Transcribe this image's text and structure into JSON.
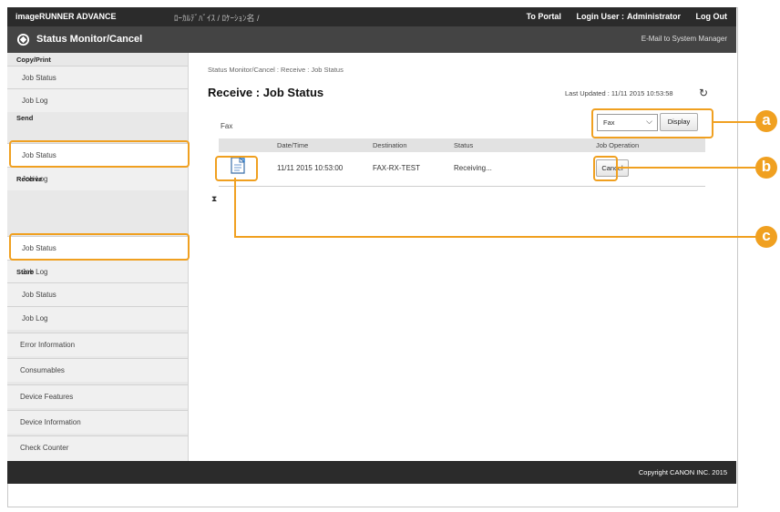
{
  "topbar": {
    "brand": "imageRUNNER ADVANCE",
    "device": "ﾛｰｶﾙﾃﾞﾊﾞｲｽ / ﾛｹｰｼｮﾝ名 /",
    "portal": "To Portal",
    "login_user": "Login User :",
    "user": "Administrator",
    "logout": "Log Out"
  },
  "subbar": {
    "title": "Status Monitor/Cancel",
    "mail_link": "E-Mail to System Manager"
  },
  "sidebar": {
    "groups": [
      {
        "heading": "Copy/Print",
        "items": [
          "Job Status",
          "Job Log"
        ]
      },
      {
        "heading": "Send",
        "items": [
          "Job Status",
          "Job Log"
        ]
      },
      {
        "heading": "Receive",
        "items": [
          "Job Status",
          "Job Log"
        ]
      },
      {
        "heading": "Store",
        "items": [
          "Job Status",
          "Job Log"
        ]
      }
    ],
    "extra_items": [
      "Error Information",
      "Consumables",
      "Device Features",
      "Device Information",
      "Check Counter"
    ]
  },
  "main": {
    "breadcrumb": "Status Monitor/Cancel : Receive : Job Status",
    "title": "Receive : Job Status",
    "last_updated": "Last Updated : 11/11 2015 10:53:58",
    "section_label": "Fax",
    "filter": {
      "selected": "Fax",
      "display_button": "Display"
    },
    "table": {
      "headers": [
        "Date/Time",
        "Destination",
        "Status",
        "Job Operation"
      ],
      "rows": [
        {
          "datetime": "11/11 2015 10:53:00",
          "destination": "FAX-RX-TEST",
          "status": "Receiving...",
          "operation": "Cancel"
        }
      ]
    }
  },
  "footer": {
    "copyright": "Copyright CANON INC. 2015"
  },
  "callouts": [
    "a",
    "b",
    "c"
  ],
  "colors": {
    "accent": "#f0a020",
    "topbar": "#2b2b2b",
    "subbar": "#444444",
    "sidebar": "#e8e8e8"
  }
}
